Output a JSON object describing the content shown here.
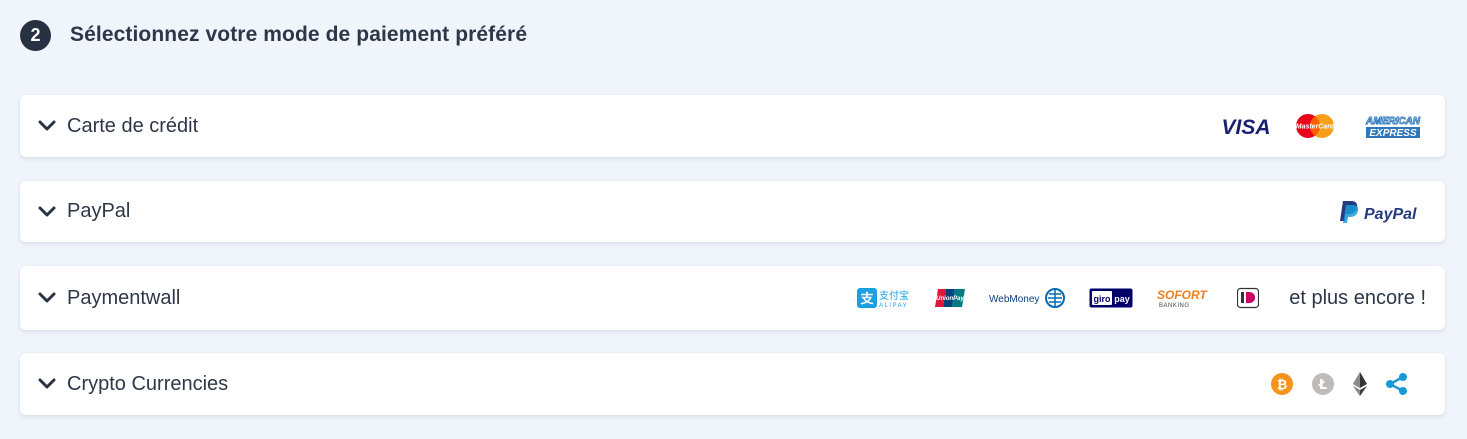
{
  "step": {
    "number": "2",
    "title": "Sélectionnez votre mode de paiement préféré"
  },
  "payment_methods": [
    {
      "label": "Carte de crédit",
      "logos": {
        "visa": "VISA",
        "mastercard": "MasterCard",
        "amex_line1": "AMERICAN",
        "amex_line2": "EXPRESS"
      }
    },
    {
      "label": "PayPal",
      "logos": {
        "paypal": "PayPal"
      }
    },
    {
      "label": "Paymentwall",
      "logos": {
        "alipay_cn": "支付宝",
        "alipay_en": "ALIPAY",
        "unionpay": "UnionPay",
        "webmoney": "WebMoney",
        "giropay_a": "giro",
        "giropay_b": "pay",
        "sofort": "SOFORT",
        "sofort_sub": "BANKING",
        "ideal": "iD"
      },
      "more": "et plus encore !"
    },
    {
      "label": "Crypto Currencies",
      "logos": {
        "bitcoin": "bitcoin-icon",
        "litecoin": "litecoin-icon",
        "ethereum": "ethereum-icon",
        "ripple": "ripple-icon"
      }
    }
  ],
  "colors": {
    "background": "#f0f4fb",
    "badge": "#273142",
    "visa": "#1a1f71",
    "paypal_dark": "#253b80",
    "paypal_light": "#179bd7",
    "bitcoin": "#f7931a",
    "litecoin": "#bfbbbb",
    "ripple": "#1a9ad6"
  }
}
